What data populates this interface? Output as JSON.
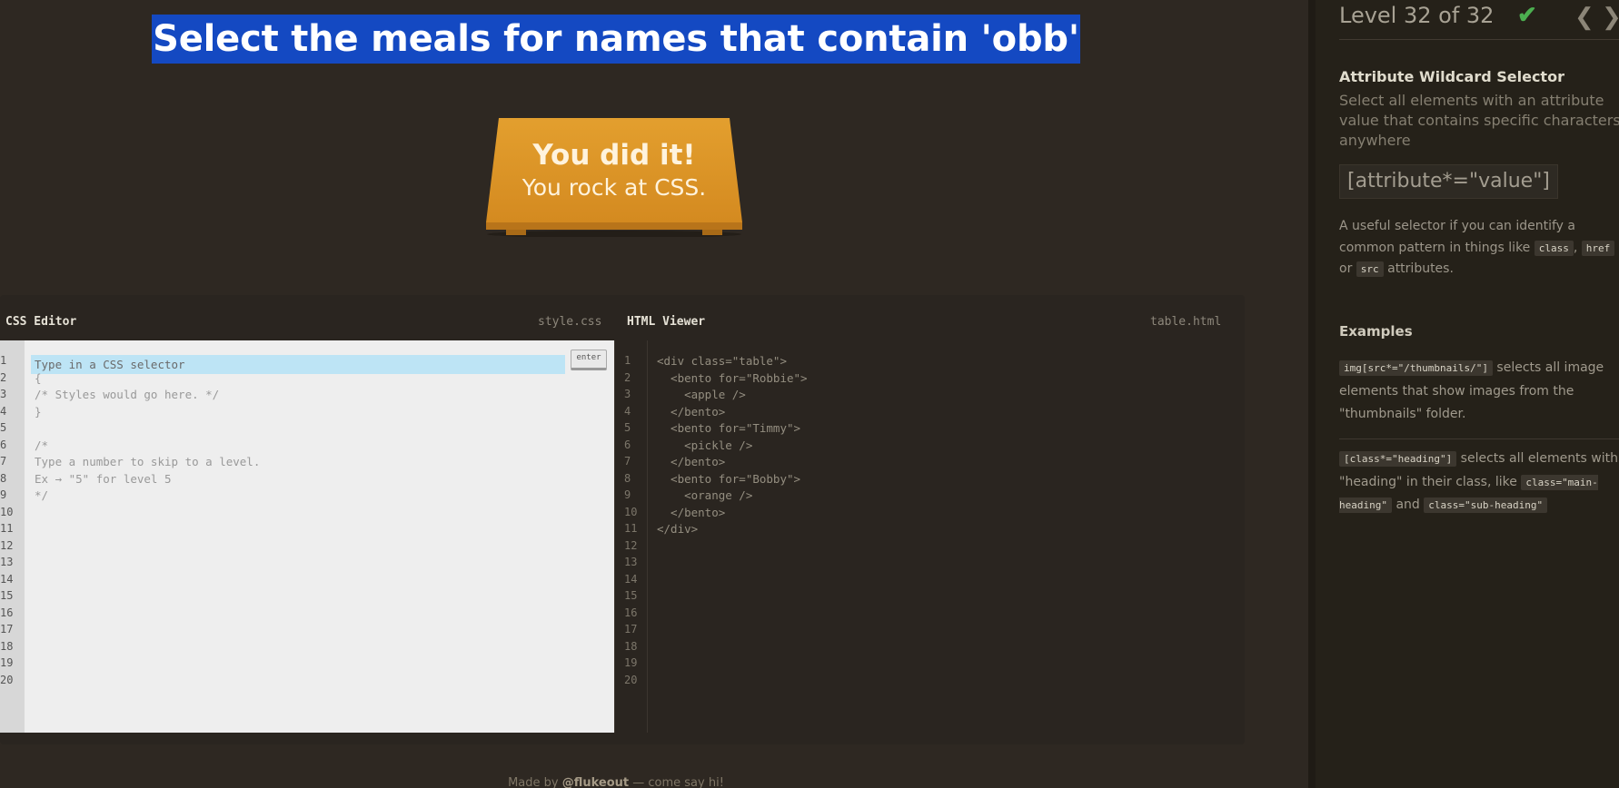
{
  "game": {
    "instruction": "Select the meals for names that contain 'obb'",
    "win_line1": "You did it!",
    "win_line2": "You rock at CSS."
  },
  "css_editor": {
    "title": "CSS Editor",
    "filename": "style.css",
    "input_placeholder": "Type in a CSS selector",
    "enter_label": "enter",
    "lines": [
      "{",
      "/* Styles would go here. */",
      "}",
      "",
      "/*",
      "Type a number to skip to a level.",
      "Ex → \"5\" for level 5",
      "*/"
    ],
    "line_numbers": [
      "1",
      "2",
      "3",
      "4",
      "5",
      "6",
      "7",
      "8",
      "9",
      "10",
      "11",
      "12",
      "13",
      "14",
      "15",
      "16",
      "17",
      "18",
      "19",
      "20"
    ]
  },
  "html_viewer": {
    "title": "HTML Viewer",
    "filename": "table.html",
    "lines": [
      "<div class=\"table\">",
      "  <bento for=\"Robbie\">",
      "    <apple />",
      "  </bento>",
      "  <bento for=\"Timmy\">",
      "    <pickle />",
      "  </bento>",
      "  <bento for=\"Bobby\">",
      "    <orange />",
      "  </bento>",
      "</div>"
    ],
    "line_numbers": [
      "1",
      "2",
      "3",
      "4",
      "5",
      "6",
      "7",
      "8",
      "9",
      "10",
      "11",
      "12",
      "13",
      "14",
      "15",
      "16",
      "17",
      "18",
      "19",
      "20"
    ]
  },
  "footer": {
    "prefix": "Made by ",
    "author": "@flukeout",
    "suffix": " — come say hi!"
  },
  "sidebar": {
    "level_title": "Level 32 of 32",
    "check_icon": "check-icon",
    "prev_icon": "chevron-left-icon",
    "next_icon": "chevron-right-icon",
    "menu_icon": "menu-icon",
    "selector_name": "Attribute Wildcard Selector",
    "selector_title": "Select all elements with an attribute value that contains specific characters anywhere",
    "syntax": "[attribute*=\"value\"]",
    "hint_text": "A useful selector if you can identify a common pattern in things like",
    "hint_code1": "class",
    "hint_sep1": ",",
    "hint_code2": "href",
    "hint_or": "or",
    "hint_code3": "src",
    "hint_end": "attributes.",
    "examples_title": "Examples",
    "example1_code": "img[src*=\"/thumbnails/\"]",
    "example1_text": "selects all image elements that show images from the \"thumbnails\" folder.",
    "example2_code": "[class*=\"heading\"]",
    "example2_text1": "selects all elements with \"heading\" in their class, like",
    "example2_code2": "class=\"main-heading\"",
    "example2_and": "and",
    "example2_code3": "class=\"sub-heading\""
  },
  "colors": {
    "background": "#2e2822",
    "instruction_highlight": "#1449c2",
    "table": "#e09a2a",
    "check": "#4caf50",
    "input_highlight": "#bde4f5"
  }
}
